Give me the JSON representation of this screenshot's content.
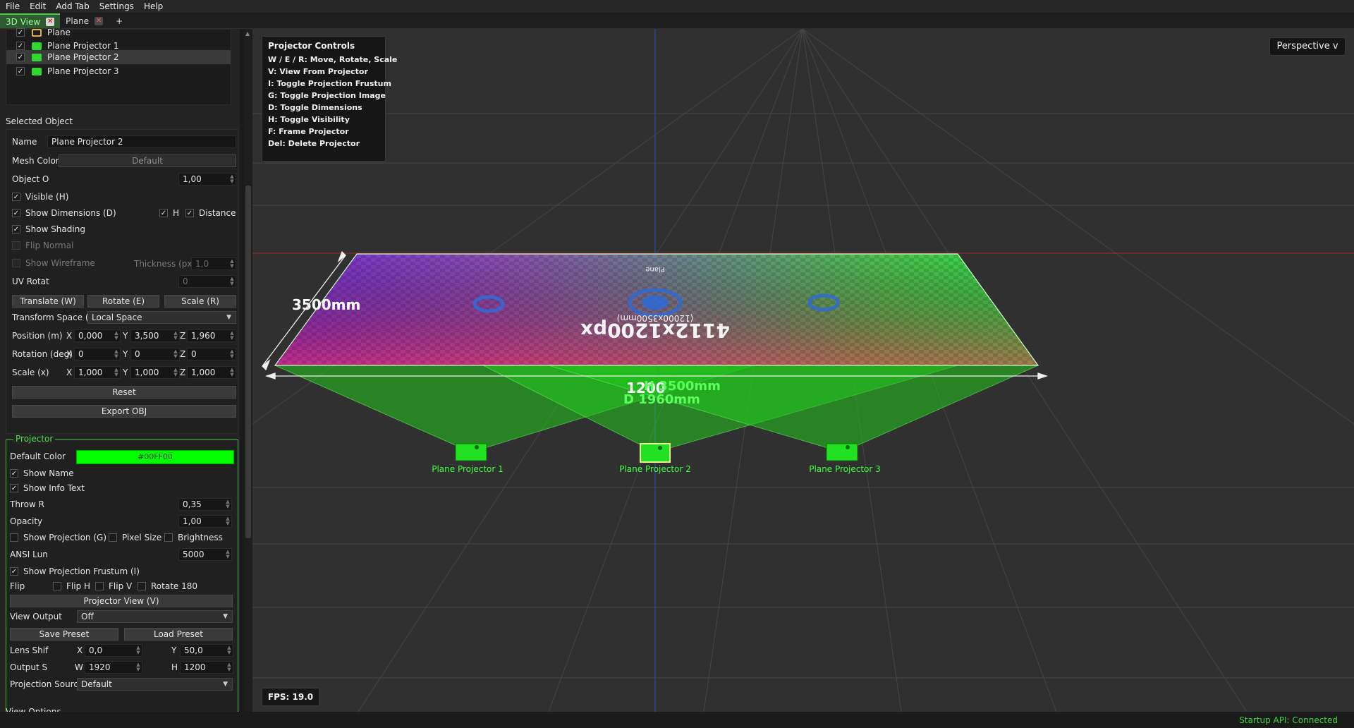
{
  "menu": [
    "File",
    "Edit",
    "Add Tab",
    "Settings",
    "Help"
  ],
  "tabs": [
    {
      "label": "3D View",
      "active": true
    },
    {
      "label": "Plane",
      "active": false
    }
  ],
  "tab_add_label": "+",
  "outliner": [
    {
      "label": "Plane",
      "type": "plane",
      "checked": true
    },
    {
      "label": "Plane Projector 1",
      "type": "projector",
      "checked": true
    },
    {
      "label": "Plane Projector 2",
      "type": "projector",
      "checked": true,
      "selected": true
    },
    {
      "label": "Plane Projector 3",
      "type": "projector",
      "checked": true
    }
  ],
  "selected": {
    "title": "Selected Object",
    "name_label": "Name",
    "name_value": "Plane Projector 2",
    "mesh_color_label": "Mesh Color",
    "mesh_color_value": "Default",
    "opacity_label": "Object O",
    "opacity_value": "1,00",
    "visible_label": "Visible (H)",
    "show_dimensions_label": "Show Dimensions (D)",
    "h_label": "H",
    "distance_label": "Distance",
    "show_shading_label": "Show Shading",
    "flip_normal_label": "Flip Normal",
    "show_wireframe_label": "Show Wireframe",
    "thickness_label": "Thickness (px)",
    "thickness_value": "1,0",
    "uv_rotate_label": "UV Rotat",
    "uv_rotate_value": "0",
    "translate_label": "Translate (W)",
    "rotate_label": "Rotate (E)",
    "scale_label": "Scale (R)",
    "transform_space_label": "Transform Space (X)",
    "transform_space_value": "Local Space",
    "position_label": "Position (m)",
    "position": {
      "x": "0,000",
      "y": "3,500",
      "z": "1,960"
    },
    "rotation_label": "Rotation (deg)",
    "rotation": {
      "x": "0",
      "y": "0",
      "z": "0"
    },
    "scale_x_label": "Scale (x)",
    "scale": {
      "x": "1,000",
      "y": "1,000",
      "z": "1,000"
    },
    "axis_x": "X",
    "axis_y": "Y",
    "axis_z": "Z",
    "reset_label": "Reset",
    "export_label": "Export OBJ"
  },
  "projector": {
    "title": "Projector",
    "default_color_label": "Default Color",
    "default_color_value": "#00FF00",
    "show_name_label": "Show Name",
    "show_info_label": "Show Info Text",
    "throw_label": "Throw R",
    "throw_value": "0,35",
    "opacity_label": "Opacity",
    "opacity_value": "1,00",
    "show_projection_label": "Show Projection (G)",
    "pixel_size_label": "Pixel Size",
    "brightness_label": "Brightness",
    "ansi_label": "ANSI Lun",
    "ansi_value": "5000",
    "frustum_label": "Show Projection Frustum (I)",
    "flip_label": "Flip",
    "flip_h_label": "Flip H",
    "flip_v_label": "Flip V",
    "rotate180_label": "Rotate 180",
    "projector_view_label": "Projector View (V)",
    "view_output_label": "View Output",
    "view_output_value": "Off",
    "save_preset_label": "Save Preset",
    "load_preset_label": "Load Preset",
    "lens_shift_label": "Lens Shif",
    "lens_x": "0,0",
    "lens_y": "50,0",
    "output_label": "Output S",
    "w_label": "W",
    "h_label": "H",
    "output_w": "1920",
    "output_h": "1200",
    "source_label": "Projection Source",
    "source_value": "Default",
    "x_label": "X",
    "y_label": "Y"
  },
  "view_options_label": "View Options",
  "viewport": {
    "controls_title": "Projector Controls",
    "controls": [
      "W / E / R: Move, Rotate, Scale",
      "V: View From Projector",
      "I: Toggle Projection Frustum",
      "G: Toggle Projection Image",
      "D: Toggle Dimensions",
      "H: Toggle Visibility",
      "F: Frame Projector",
      "Del: Delete Projector"
    ],
    "perspective_label": "Perspective v",
    "fps_label": "FPS: 19.0",
    "dim_depth": "3500mm",
    "dim_width": "1200",
    "dim_h": "H 3500mm",
    "dim_d": "D 1960mm",
    "plane_label": "Plane",
    "plane_res": "4112x1200px",
    "plane_mm": "(12000x3500mm)",
    "projector_names": [
      "Plane Projector 1",
      "Plane Projector 2",
      "Plane Projector 3"
    ],
    "projector_color": "#00FF00"
  },
  "status": {
    "api": "Startup API: Connected"
  }
}
